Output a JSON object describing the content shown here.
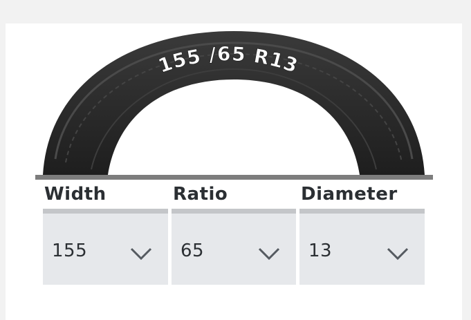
{
  "tire": {
    "size_text": "155 /65 R13"
  },
  "fields": [
    {
      "label": "Width",
      "value": "155",
      "icon": "chevron-down-icon"
    },
    {
      "label": "Ratio",
      "value": "65",
      "icon": "chevron-down-icon"
    },
    {
      "label": "Diameter",
      "value": "13",
      "icon": "chevron-down-icon"
    }
  ],
  "colors": {
    "tire": "#2e2e2e",
    "select_bg": "#e6e8eb",
    "select_top": "#c4c6c9",
    "baseline": "#7d7d7d",
    "text": "#2b2f33"
  }
}
